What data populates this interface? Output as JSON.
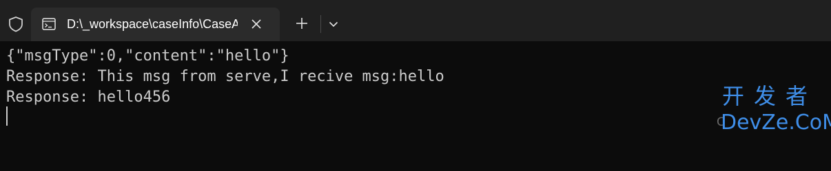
{
  "tab": {
    "title": "D:\\_workspace\\caseInfo\\CaseA",
    "icon": "terminal-icon"
  },
  "toolbar": {
    "shield_icon": "shield-icon",
    "new_tab_icon": "plus-icon",
    "dropdown_icon": "chevron-down-icon",
    "close_icon": "close-icon"
  },
  "terminal": {
    "lines": [
      "{\"msgType\":0,\"content\":\"hello\"}",
      "Response: This msg from serve,I recive msg:hello",
      "Response: hello456"
    ]
  },
  "watermark": {
    "cn": "开发者",
    "en": "DevZe.CoM",
    "faint": "C"
  },
  "colors": {
    "background": "#0c0c0c",
    "tabbar": "#202020",
    "tab_active": "#2b2b2b",
    "text": "#cccccc",
    "watermark": "#3f8ee8"
  }
}
